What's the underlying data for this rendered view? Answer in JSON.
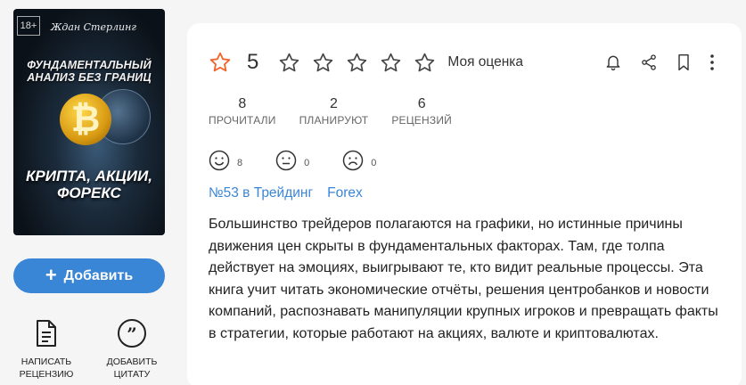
{
  "book": {
    "age_rating": "18+",
    "author": "Ждан Стерлинг",
    "cover_title_top": "ФУНДАМЕНТАЛЬНЫЙ АНАЛИЗ БЕЗ ГРАНИЦ",
    "cover_title_bottom": "КРИПТА, АКЦИИ, ФОРЕКС",
    "cover_symbol": "₿"
  },
  "add_button": {
    "icon": "+",
    "label": "Добавить"
  },
  "actions": [
    {
      "icon": "document-icon",
      "label_line1": "НАПИСАТЬ",
      "label_line2": "РЕЦЕНЗИЮ"
    },
    {
      "icon": "quote-icon",
      "label_line1": "ДОБАВИТЬ",
      "label_line2": "ЦИТАТУ"
    }
  ],
  "rating": {
    "value": "5",
    "my_rating_label": "Моя оценка",
    "accent_color": "#f0642d"
  },
  "stats": [
    {
      "value": "8",
      "label": "ПРОЧИТАЛИ"
    },
    {
      "value": "2",
      "label": "ПЛАНИРУЮТ"
    },
    {
      "value": "6",
      "label": "РЕЦЕНЗИЙ"
    }
  ],
  "reactions": [
    {
      "icon": "smile-icon",
      "count": "8"
    },
    {
      "icon": "neutral-face-icon",
      "count": "0"
    },
    {
      "icon": "sad-face-icon",
      "count": "0"
    }
  ],
  "tags": [
    {
      "label": "№53 в Трейдинг"
    },
    {
      "label": "Forex"
    }
  ],
  "description": "Большинство трейдеров полагаются на графики, но истинные причины движения цен скрыты в фундаментальных факторах. Там, где толпа действует на эмоциях, выигрывают те, кто видит реальные процессы. Эта книга учит читать экономические отчёты, решения центробанков и новости компаний, распознавать манипуляции крупных игроков и превращать факты в стратегии, которые работают на акциях, валюте и криптовалютах.",
  "colors": {
    "link": "#3a86d6",
    "button": "#3a86d6"
  }
}
